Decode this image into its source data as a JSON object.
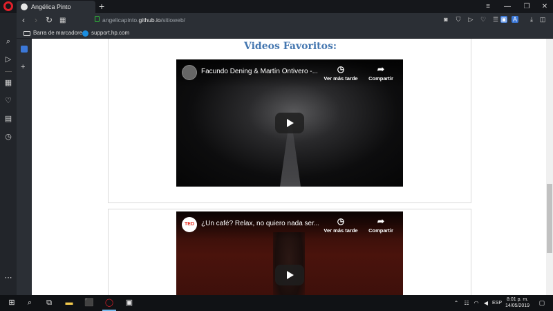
{
  "browser": {
    "tab_title": "Angélica Pinto",
    "new_tab_icon": "+",
    "url_prefix": "angelicapinto.",
    "url_host": "github.io",
    "url_path": "/sitioweb/"
  },
  "bookmarks": [
    {
      "label": "Barra de marcadore..."
    },
    {
      "label": "support.hp.com"
    }
  ],
  "page": {
    "section_title": "Videos Favoritos:"
  },
  "videos": [
    {
      "title": "Facundo Dening & Martín Ontivero -...",
      "watch_later": "Ver más tarde",
      "share": "Compartir"
    },
    {
      "channel_badge": "TED",
      "title": "¿Un café? Relax, no quiero nada ser...",
      "watch_later": "Ver más tarde",
      "share": "Compartir"
    }
  ],
  "taskbar": {
    "language": "ESP",
    "time": "8:01 p. m.",
    "date": "14/05/2019"
  },
  "colors": {
    "accent_title": "#4577b0",
    "opera_red": "#e0202a"
  }
}
